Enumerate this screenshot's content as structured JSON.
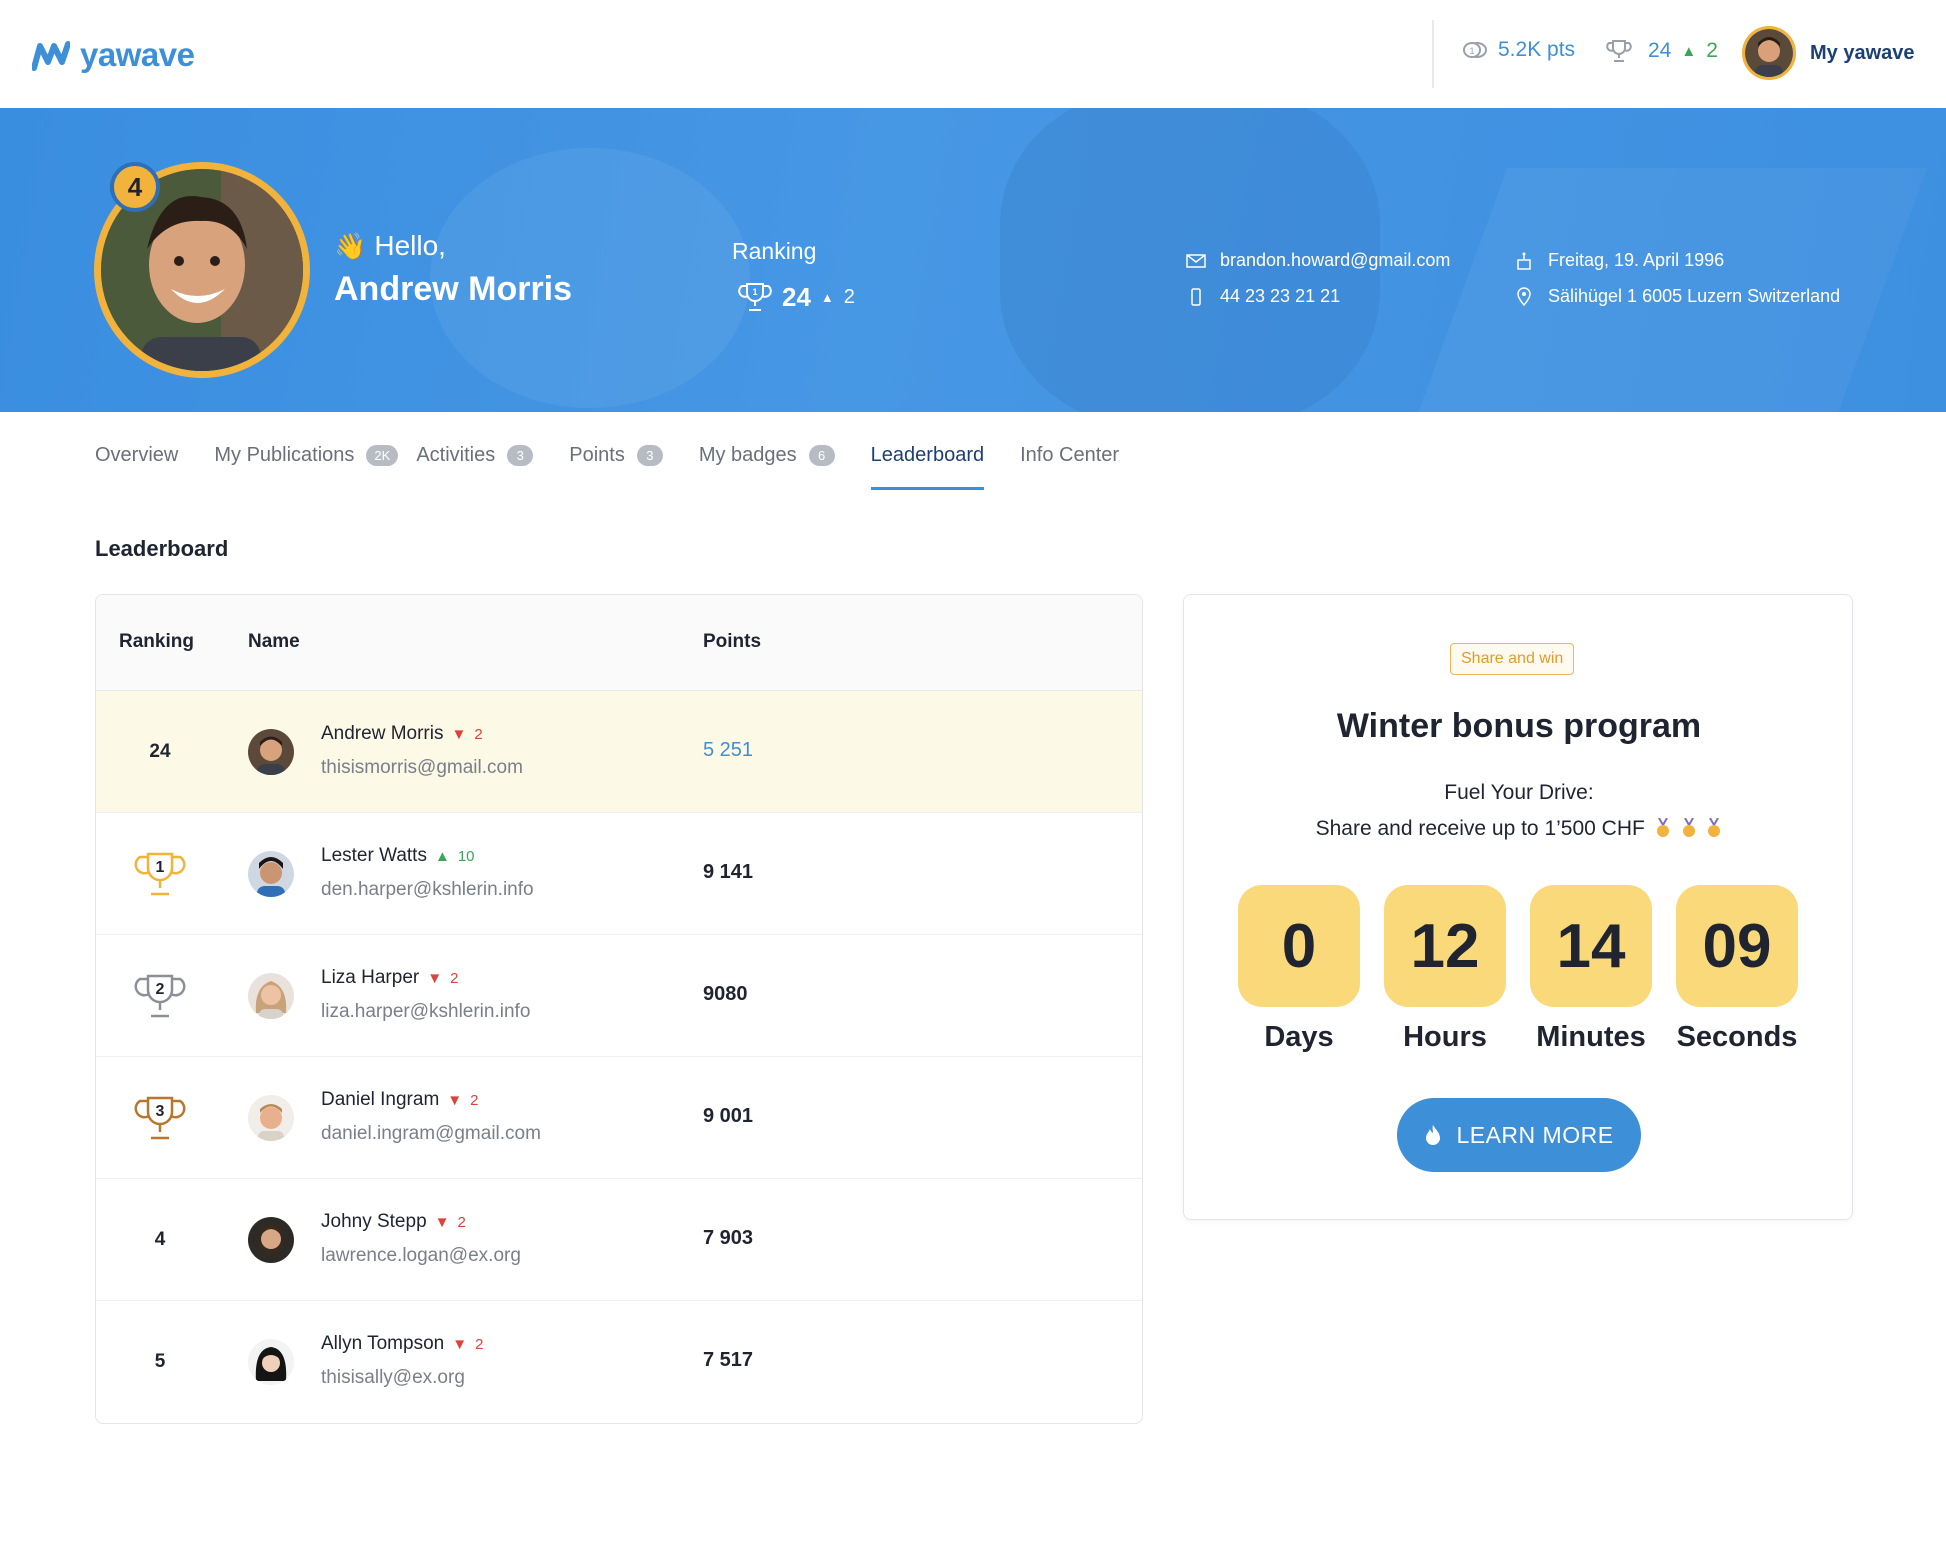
{
  "topbar": {
    "logo_text": "yawave",
    "points": "5.2K pts",
    "rank": "24",
    "rank_delta": "2",
    "user_label": "My yawave"
  },
  "hero": {
    "level_badge": "4",
    "hello": "Hello,",
    "name": "Andrew Morris",
    "ranking_label": "Ranking",
    "rank": "24",
    "rank_delta": "2",
    "email": "brandon.howard@gmail.com",
    "phone": "44 23 23 21 21",
    "birthday": "Freitag, 19. April 1996",
    "address": "Sälihügel 1 6005 Luzern Switzerland"
  },
  "tabs": [
    {
      "label": "Overview",
      "count": ""
    },
    {
      "label": "My Publications",
      "count": "2K"
    },
    {
      "label": "Activities",
      "count": "3"
    },
    {
      "label": "Points",
      "count": "3"
    },
    {
      "label": "My badges",
      "count": "6"
    },
    {
      "label": "Leaderboard",
      "count": ""
    },
    {
      "label": "Info Center",
      "count": ""
    }
  ],
  "leaderboard": {
    "title": "Leaderboard",
    "columns": {
      "ranking": "Ranking",
      "name": "Name",
      "points": "Points"
    },
    "rows": [
      {
        "rank": "24",
        "name": "Andrew Morris",
        "delta": "2",
        "email": "thisismorris@gmail.com",
        "points": "5 251"
      },
      {
        "rank": "1",
        "name": "Lester Watts",
        "delta": "10",
        "email": "den.harper@kshlerin.info",
        "points": "9 141"
      },
      {
        "rank": "2",
        "name": "Liza Harper",
        "delta": "2",
        "email": "liza.harper@kshlerin.info",
        "points": "9080"
      },
      {
        "rank": "3",
        "name": "Daniel Ingram",
        "delta": "2",
        "email": "daniel.ingram@gmail.com",
        "points": "9 001"
      },
      {
        "rank": "4",
        "name": "Johny Stepp",
        "delta": "2",
        "email": "lawrence.logan@ex.org",
        "points": "7 903"
      },
      {
        "rank": "5",
        "name": "Allyn Tompson",
        "delta": "2",
        "email": "thisisally@ex.org",
        "points": "7 517"
      }
    ]
  },
  "promo": {
    "tag": "Share and win",
    "title": "Winter bonus program",
    "subtitle1": "Fuel Your Drive:",
    "subtitle2": "Share and receive up to 1’500 CHF",
    "countdown": [
      {
        "value": "0",
        "label": "Days"
      },
      {
        "value": "12",
        "label": "Hours"
      },
      {
        "value": "14",
        "label": "Minutes"
      },
      {
        "value": "09",
        "label": "Seconds"
      }
    ],
    "button": "LEARN MORE"
  },
  "colors": {
    "accent": "#3d8fd8",
    "hero_bg": "#4697e4",
    "gold": "#f2b33d",
    "counter_bg": "#f9d97a",
    "down": "#d9443b",
    "up": "#3aa757"
  }
}
